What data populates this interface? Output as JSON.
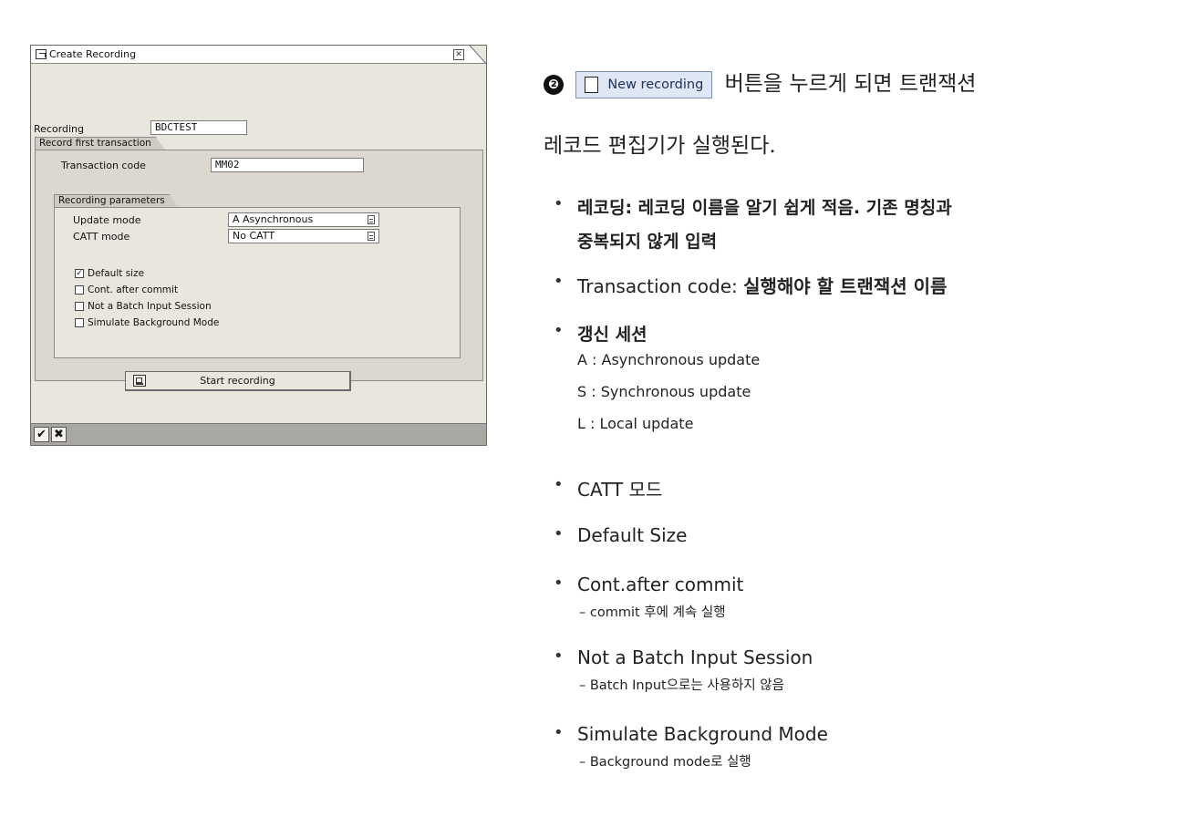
{
  "dialog": {
    "title": "Create Recording",
    "close_icon": "close-icon",
    "recording_label": "Recording",
    "recording_value": "BDCTEST",
    "first_transaction_group": "Record first transaction",
    "transaction_code_label": "Transaction code",
    "transaction_code_value": "MM02",
    "params_group": "Recording parameters",
    "update_mode_label": "Update mode",
    "update_mode_value": "A Asynchronous",
    "catt_mode_label": "CATT mode",
    "catt_mode_value": "No CATT",
    "checkboxes": [
      {
        "label": "Default size",
        "checked": true
      },
      {
        "label": "Cont. after commit",
        "checked": false
      },
      {
        "label": "Not a Batch Input Session",
        "checked": false
      },
      {
        "label": "Simulate Background Mode",
        "checked": false
      }
    ],
    "start_button": "Start recording",
    "confirm_glyph": "✔",
    "cancel_glyph": "✖"
  },
  "explanation": {
    "badge": "❷",
    "new_recording_button": "New recording",
    "intro_line1_suffix": "버튼을 누르게 되면 트랜잭션",
    "intro_line2": "레코드 편집기가 실행된다.",
    "bullet_glyph": "•",
    "items": {
      "recording_1": "레코딩: 레코딩 이름을 알기 쉽게 적음. 기존 명칭과",
      "recording_2": "중복되지 않게 입력",
      "tcode_en": "Transaction code: ",
      "tcode_ko": "실행해야 할 트랜잭션 이름",
      "update": "갱신 세션",
      "update_a": "A : Asynchronous update",
      "update_s": "S : Synchronous update",
      "update_l": "L : Local update",
      "catt": "CATT 모드",
      "default_size": "Default Size",
      "cont": "Cont.after commit",
      "cont_sub": "– commit 후에 계속 실행",
      "batch": "Not a Batch Input Session",
      "batch_sub": "– Batch Input으로는 사용하지 않음",
      "simulate": "Simulate Background Mode",
      "simulate_sub": "– Background mode로 실행"
    }
  }
}
